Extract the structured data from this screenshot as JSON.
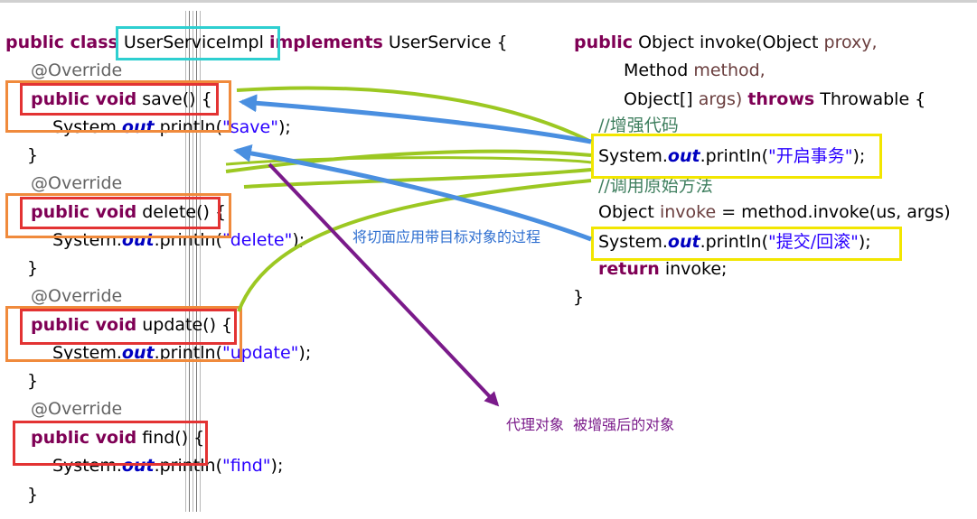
{
  "left_code": {
    "class_kw": "public class",
    "class_name": "UserServiceImpl",
    "implements_kw": "implements",
    "interface_name": "UserService {",
    "override": "@Override",
    "method_kw": "public void",
    "sys_prefix": "System.",
    "out_field": "out",
    "println": ".println(",
    "line_end": ");",
    "close_brace": "}",
    "methods": [
      {
        "signature": "save() {",
        "string": "\"save\""
      },
      {
        "signature": "delete() {",
        "string": "\"delete\""
      },
      {
        "signature": "update() {",
        "string": "\"update\""
      },
      {
        "signature": "find() {",
        "string": "\"find\""
      }
    ]
  },
  "right_code": {
    "public_kw": "public",
    "invoke_sig": "Object invoke(Object",
    "proxy_param": "proxy,",
    "method_type": "Method",
    "method_param": "method,",
    "args_type": "Object[]",
    "args_param": "args)",
    "throws_kw": "throws",
    "throwable": "Throwable {",
    "comment_enhance": "//增强代码",
    "begin_tx": "\"开启事务\"",
    "comment_call": "//调用原始方法",
    "invoke_call_a": "Object",
    "invoke_var": "invoke",
    "invoke_call_b": "= method.invoke(us, args)",
    "commit_tx": "\"提交/回滚\"",
    "return_kw": "return",
    "return_val": "invoke;",
    "close_brace": "}"
  },
  "notes": {
    "weave": "将切面应用带目标对象的过程",
    "proxy": "代理对象  被增强后的对象"
  },
  "colors": {
    "keyword": "#7f0055",
    "string": "#2a00ff",
    "field": "#0000c0",
    "box_cyan": "#2ecfd0",
    "box_orange": "#f08a3c",
    "box_red": "#e33333",
    "box_yellow": "#f2e600",
    "arrow_blue": "#4a8fe0",
    "curve_green": "#9cc822",
    "arrow_purple": "#7a1a8a"
  }
}
